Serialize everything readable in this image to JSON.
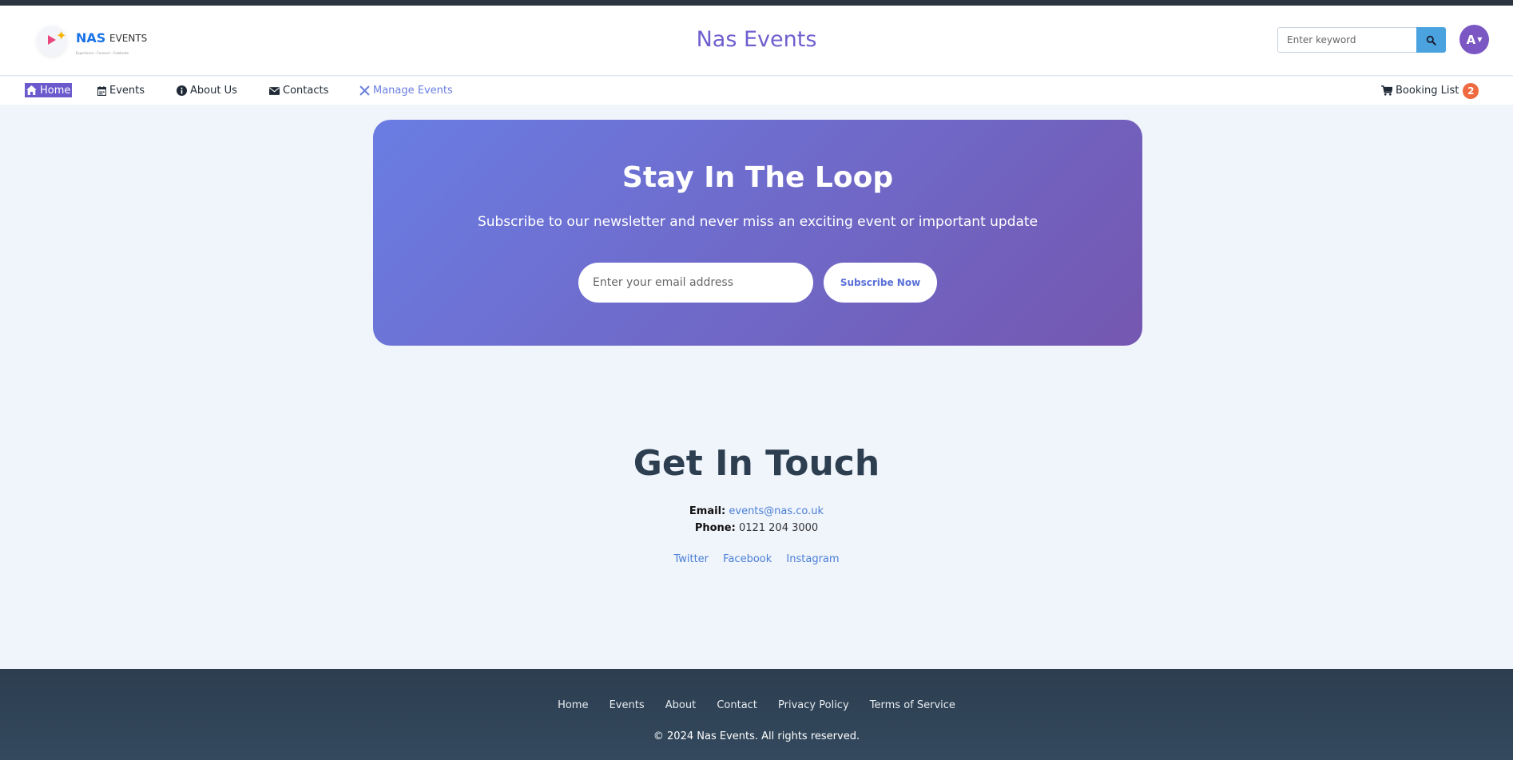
{
  "header": {
    "logo_brand": "NAS",
    "logo_sub": "EVENTS",
    "logo_tagline": "Experience · Connect · Celebrate",
    "site_title": "Nas Events",
    "search_placeholder": "Enter keyword",
    "avatar_initial": "A"
  },
  "nav": {
    "items": [
      {
        "label": "Home",
        "icon": "home-icon"
      },
      {
        "label": "Events",
        "icon": "calendar-icon"
      },
      {
        "label": "About Us",
        "icon": "info-icon"
      },
      {
        "label": "Contacts",
        "icon": "envelope-icon"
      },
      {
        "label": "Manage Events",
        "icon": "tools-icon"
      }
    ],
    "booking_label": "Booking List",
    "booking_count": "2"
  },
  "newsletter": {
    "title": "Stay In The Loop",
    "subtitle": "Subscribe to our newsletter and never miss an exciting event or important update",
    "email_placeholder": "Enter your email address",
    "button_label": "Subscribe Now"
  },
  "contact": {
    "title": "Get In Touch",
    "email_label": "Email:",
    "email_value": "events@nas.co.uk",
    "phone_label": "Phone:",
    "phone_value": "0121 204 3000",
    "social": [
      "Twitter",
      "Facebook",
      "Instagram"
    ]
  },
  "footer": {
    "links": [
      "Home",
      "Events",
      "About",
      "Contact",
      "Privacy Policy",
      "Terms of Service"
    ],
    "copyright": "© 2024 Nas Events. All rights reserved."
  },
  "colors": {
    "accent": "#6a5acd",
    "gradient_start": "#6a7de3",
    "gradient_end": "#7457b0",
    "footer": "#2c3e50",
    "badge": "#ef6a40",
    "link": "#4a7fd6"
  }
}
